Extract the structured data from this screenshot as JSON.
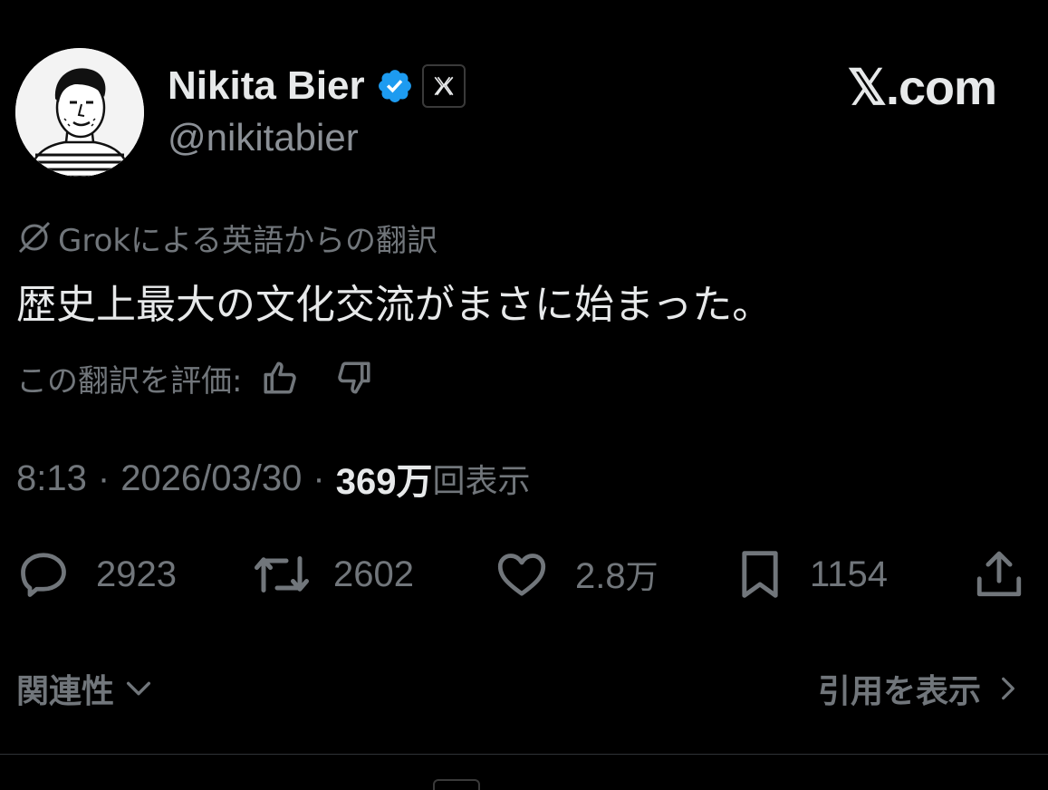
{
  "author": {
    "display_name": "Nikita Bier",
    "handle": "@nikitabier",
    "verified_icon": "verified-badge-icon",
    "affiliation_icon": "x-logo-icon"
  },
  "brand": {
    "text": "𝕏.com"
  },
  "translation": {
    "label": "Grokによる英語からの翻訳",
    "text": "歴史上最大の文化交流がまさに始まった。",
    "rate_label": "この翻訳を評価:"
  },
  "meta": {
    "time": "8:13",
    "date": "2026/03/30",
    "separator": "·",
    "views_number": "369万",
    "views_unit": "回表示"
  },
  "actions": {
    "replies": "2923",
    "reposts": "2602",
    "likes_number": "2.8",
    "likes_unit": "万",
    "bookmarks": "1154"
  },
  "footer": {
    "related_label": "関連性",
    "quotes_label": "引用を表示"
  },
  "colors": {
    "background": "#000000",
    "text_primary": "#e7e9ea",
    "text_secondary": "#71767b",
    "verified_blue": "#1d9bf0",
    "divider": "#2f3336"
  }
}
